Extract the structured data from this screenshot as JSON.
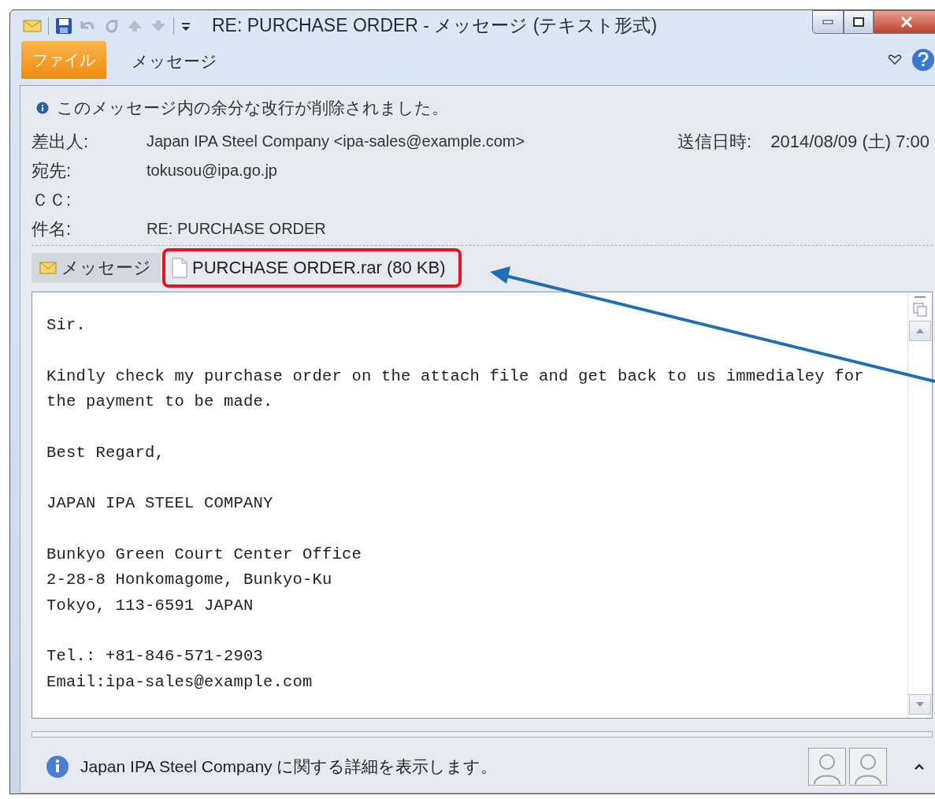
{
  "window": {
    "title": "RE: PURCHASE ORDER - メッセージ (テキスト形式)"
  },
  "ribbon_tabs": [
    {
      "label": "ファイル",
      "kind": "file"
    },
    {
      "label": "メッセージ",
      "kind": "tab"
    }
  ],
  "info_bar": "このメッセージ内の余分な改行が削除されました。",
  "header_fields": [
    {
      "label": "差出人:",
      "value": "Japan IPA Steel Company <ipa-sales@example.com>"
    },
    {
      "label": "宛先:",
      "value": "tokusou@ipa.go.jp"
    },
    {
      "label": "ＣＣ:"
    },
    {
      "label": "件名:",
      "value": "RE: PURCHASE ORDER"
    }
  ],
  "sent": {
    "label": "送信日時:",
    "value": "2014/08/09 (土) 7:00"
  },
  "attachment_tabs": [
    {
      "label": "メッセージ",
      "kind": "message",
      "selected": true,
      "highlighted": false
    },
    {
      "label": "PURCHASE ORDER.rar (80 KB)",
      "kind": "file",
      "selected": false,
      "highlighted": true
    }
  ],
  "body": [
    {
      "lines": [
        "Sir."
      ]
    },
    {
      "lines": [
        "Kindly check my purchase order on the attach file and get back to us immedialey for",
        "the payment to be made."
      ]
    },
    {
      "lines": [
        "Best Regard,"
      ]
    },
    {
      "lines": [
        "JAPAN IPA STEEL COMPANY"
      ]
    },
    {
      "lines": [
        "Bunkyo Green Court Center Office",
        "2-28-8 Honkomagome, Bunkyo-Ku",
        "Tokyo, 113-6591 JAPAN"
      ]
    },
    {
      "lines": [
        "Tel.: +81-846-571-2903",
        "Email:ipa-sales@example.com"
      ]
    }
  ],
  "people_pane": {
    "text": "Japan IPA Steel Company に関する詳細を表示します。"
  }
}
